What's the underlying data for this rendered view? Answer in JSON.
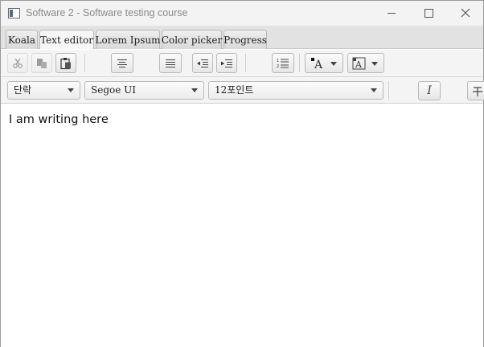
{
  "window": {
    "title": "Software 2 - Software testing course"
  },
  "tabs": [
    {
      "label": "Koala",
      "active": false
    },
    {
      "label": "Text editor",
      "active": true
    },
    {
      "label": "Lorem Ipsum",
      "active": false
    },
    {
      "label": "Color picker",
      "active": false
    },
    {
      "label": "Progress",
      "active": false
    }
  ],
  "toolbar": {
    "buttons": [
      {
        "icon": "cut-icon",
        "enabled": false
      },
      {
        "icon": "copy-icon",
        "enabled": false
      },
      {
        "icon": "paste-icon",
        "enabled": true
      },
      {
        "icon": "align-center-icon",
        "enabled": true
      },
      {
        "icon": "align-justify-icon",
        "enabled": true
      },
      {
        "icon": "outdent-icon",
        "enabled": true
      },
      {
        "icon": "indent-icon",
        "enabled": true
      },
      {
        "icon": "numbered-list-icon",
        "enabled": true
      },
      {
        "icon": "text-color-icon",
        "enabled": true
      },
      {
        "icon": "background-color-icon",
        "enabled": true
      }
    ]
  },
  "format": {
    "paragraph_style": "단락",
    "font_family": "Segoe UI",
    "font_size": "12포인트"
  },
  "editor": {
    "text": "I am writing here"
  },
  "colors": {
    "titlebar_bg": "#f3f3f3",
    "tabbar_bg": "#e2e2e2",
    "toolbar_bg": "#f4f4f4"
  }
}
